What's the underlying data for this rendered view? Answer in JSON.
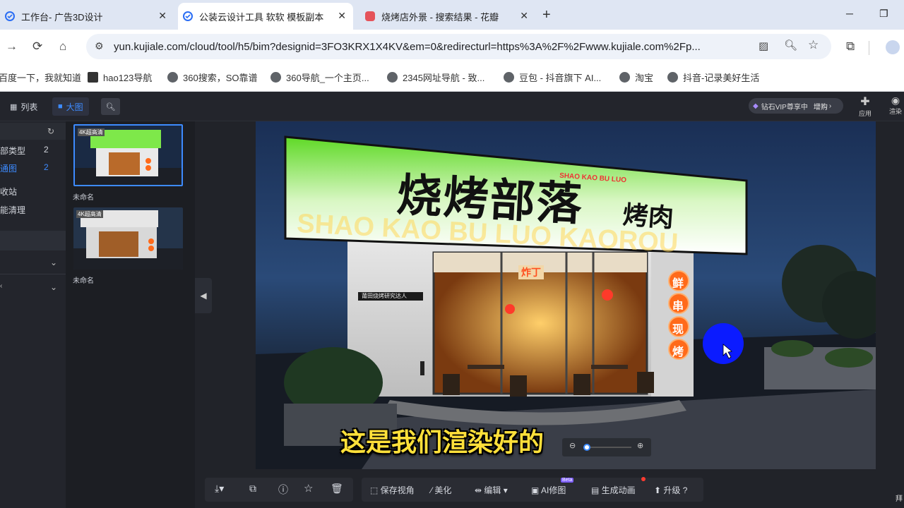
{
  "browser": {
    "tabs": [
      {
        "label": "工作台- 广告3D设计"
      },
      {
        "label": "公装云设计工具 软软 模板副本"
      },
      {
        "label": "烧烤店外景 - 搜索结果 - 花瓣"
      }
    ],
    "new_tab": "+",
    "url": "yun.kujiale.com/cloud/tool/h5/bim?designid=3FO3KRX1X4KV&em=0&redirecturl=https%3A%2F%2Fwww.kujiale.com%2Fp...",
    "bookmarks": [
      "百度一下，我就知道",
      "hao123导航",
      "360搜索，SO靠谱",
      "360导航_一个主页...",
      "2345网址导航 - 致...",
      "豆包 - 抖音旗下 AI...",
      "淘宝",
      "抖音-记录美好生活"
    ]
  },
  "app": {
    "view_list": "列表",
    "view_grid": "大图",
    "vip_text": "钻石VIP尊享中",
    "vip_action": "增购",
    "apps_label": "应用",
    "render_label": "渲染",
    "left_items": [
      {
        "label": "部类型",
        "count": "2"
      },
      {
        "label": "通图",
        "count": "2"
      },
      {
        "label": "收站",
        "count": ""
      },
      {
        "label": "能清理",
        "count": ""
      }
    ],
    "thumbnails": [
      {
        "badge": "4K超高清",
        "name": "未命名"
      },
      {
        "badge": "4K超高清",
        "name": "未命名"
      }
    ],
    "bottom_toolbar": [
      "保存视角",
      "美化",
      "编辑",
      "AI修图",
      "生成动画",
      "升级"
    ],
    "beta_badge": "Beta",
    "right_edge": "拜",
    "zoom_value": 0.05
  },
  "scene": {
    "sign_main": "烧烤部落",
    "sign_side": "烤肉",
    "sign_pinyin": "SHAO KAO BU LUO",
    "sign_lower": "SHAO KAO BU LUO KAOROU",
    "lanterns": [
      "鲜",
      "串",
      "现",
      "烤"
    ],
    "wall_plaque": "莆田烧烤研究达人",
    "window_sign": "炸丁"
  },
  "subtitle": "这是我们渲染好的",
  "colors": {
    "accent": "#2a6df4",
    "sign_green": "#6be23c",
    "subtitle_yellow": "#ffe03a",
    "lantern_orange": "#ff6a1a"
  }
}
